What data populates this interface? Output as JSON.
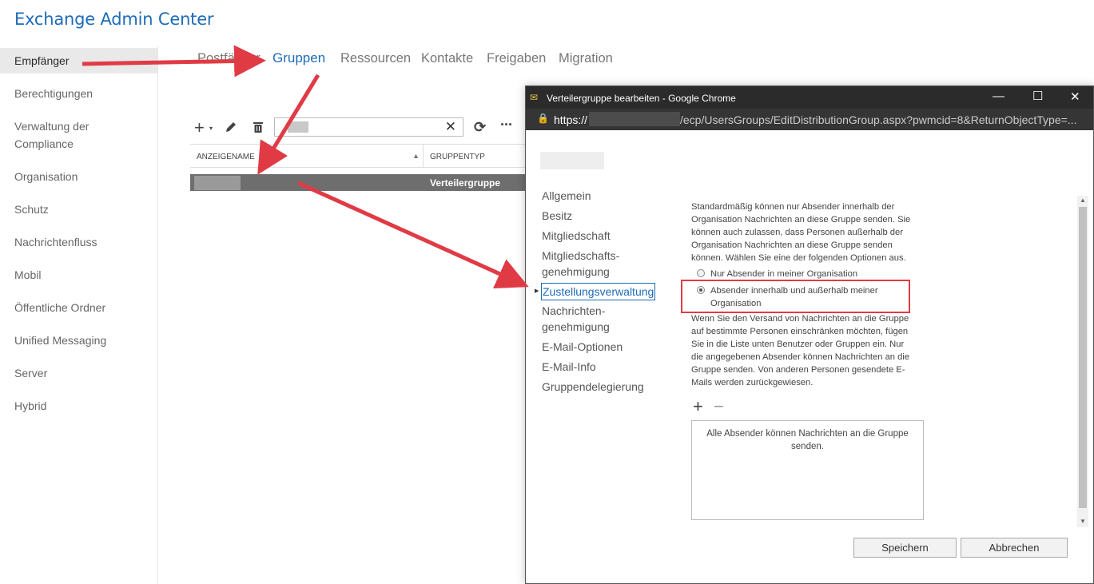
{
  "app": {
    "title": "Exchange Admin Center"
  },
  "sidebar": {
    "items": [
      {
        "label": "Empfänger"
      },
      {
        "label": "Berechtigungen"
      },
      {
        "label": "Verwaltung der"
      },
      {
        "label": "Compliance"
      },
      {
        "label": "Organisation"
      },
      {
        "label": "Schutz"
      },
      {
        "label": "Nachrichtenfluss"
      },
      {
        "label": "Mobil"
      },
      {
        "label": "Öffentliche Ordner"
      },
      {
        "label": "Unified Messaging"
      },
      {
        "label": "Server"
      },
      {
        "label": "Hybrid"
      }
    ]
  },
  "topnav": {
    "tabs": [
      {
        "label": "Postfächer"
      },
      {
        "label": "Gruppen"
      },
      {
        "label": "Ressourcen"
      },
      {
        "label": "Kontakte"
      },
      {
        "label": "Freigaben"
      },
      {
        "label": "Migration"
      }
    ]
  },
  "grid": {
    "headers": [
      "ANZEIGENAME",
      "GRUPPENTYP"
    ],
    "rows": [
      {
        "type": "Verteilergruppe"
      }
    ]
  },
  "dialog": {
    "window_title": "Verteilergruppe bearbeiten - Google Chrome",
    "url_protocol": "https://",
    "url_path": "/ecp/UsersGroups/EditDistributionGroup.aspx?pwmcid=8&ReturnObjectType=...",
    "nav": [
      {
        "label": "Allgemein"
      },
      {
        "label": "Besitz"
      },
      {
        "label": "Mitgliedschaft"
      },
      {
        "label": "Mitgliedschafts-"
      },
      {
        "label": "genehmigung"
      },
      {
        "label": "Zustellungsverwaltung"
      },
      {
        "label": "Nachrichten-"
      },
      {
        "label": "genehmigung"
      },
      {
        "label": "E-Mail-Optionen"
      },
      {
        "label": "E-Mail-Info"
      },
      {
        "label": "Gruppendelegierung"
      }
    ],
    "intro_lines": [
      "Standardmäßig können nur Absender innerhalb der",
      "Organisation Nachrichten an diese Gruppe senden. Sie",
      "können auch zulassen, dass Personen außerhalb der",
      "Organisation Nachrichten an diese Gruppe senden",
      "können. Wählen Sie eine der folgenden Optionen aus."
    ],
    "option1": "Nur Absender in meiner Organisation",
    "option2_line1": "Absender innerhalb und außerhalb meiner",
    "option2_line2": "Organisation",
    "restrict_lines": [
      "Wenn Sie den Versand von Nachrichten an die Gruppe",
      "auf bestimmte Personen einschränken möchten, fügen",
      "Sie in die Liste unten Benutzer oder Gruppen ein. Nur",
      "die angegebenen Absender können Nachrichten an die",
      "Gruppe senden. Von anderen Personen gesendete E-",
      "Mails werden zurückgewiesen."
    ],
    "list_line1": "Alle Absender können Nachrichten an die Gruppe",
    "list_line2": "senden.",
    "save_label": "Speichern",
    "cancel_label": "Abbrechen"
  },
  "colors": {
    "accent": "#1e6bb8",
    "annotation": "#e03b45"
  }
}
